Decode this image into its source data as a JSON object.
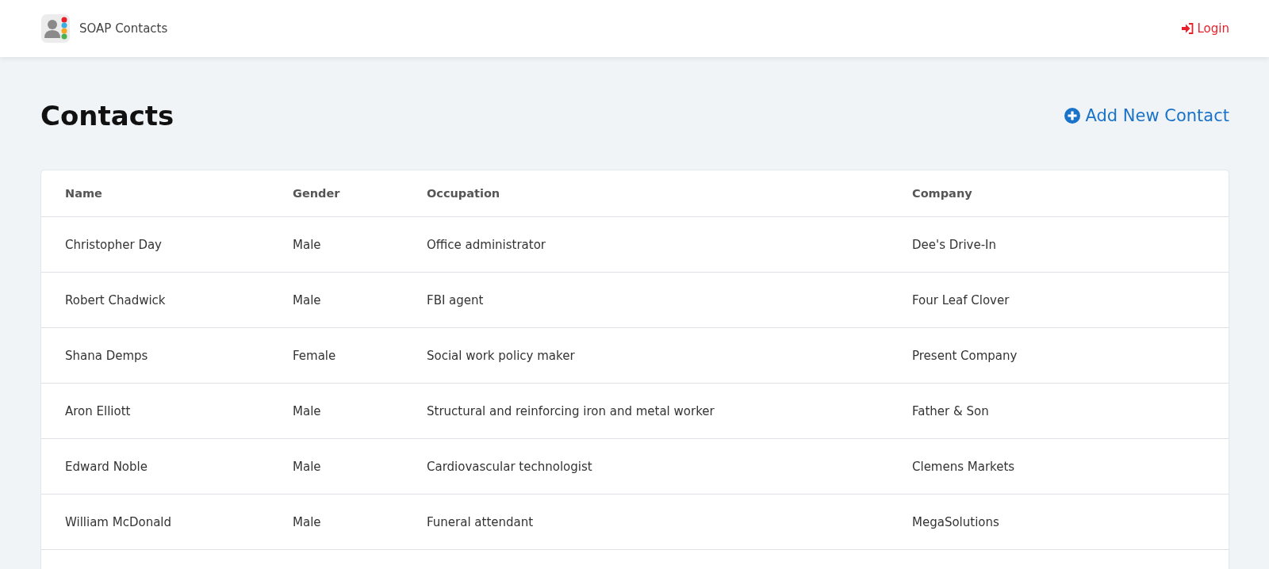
{
  "navbar": {
    "brand": "SOAP Contacts",
    "login": "Login"
  },
  "page": {
    "title": "Contacts",
    "add_button": "Add New Contact"
  },
  "table": {
    "columns": [
      "Name",
      "Gender",
      "Occupation",
      "Company"
    ],
    "rows": [
      [
        "Christopher Day",
        "Male",
        "Office administrator",
        "Dee's Drive-In"
      ],
      [
        "Robert Chadwick",
        "Male",
        "FBI agent",
        "Four Leaf Clover"
      ],
      [
        "Shana Demps",
        "Female",
        "Social work policy maker",
        "Present Company"
      ],
      [
        "Aron Elliott",
        "Male",
        "Structural and reinforcing iron and metal worker",
        "Father & Son"
      ],
      [
        "Edward Noble",
        "Male",
        "Cardiovascular technologist",
        "Clemens Markets"
      ],
      [
        "William McDonald",
        "Male",
        "Funeral attendant",
        "MegaSolutions"
      ]
    ]
  }
}
